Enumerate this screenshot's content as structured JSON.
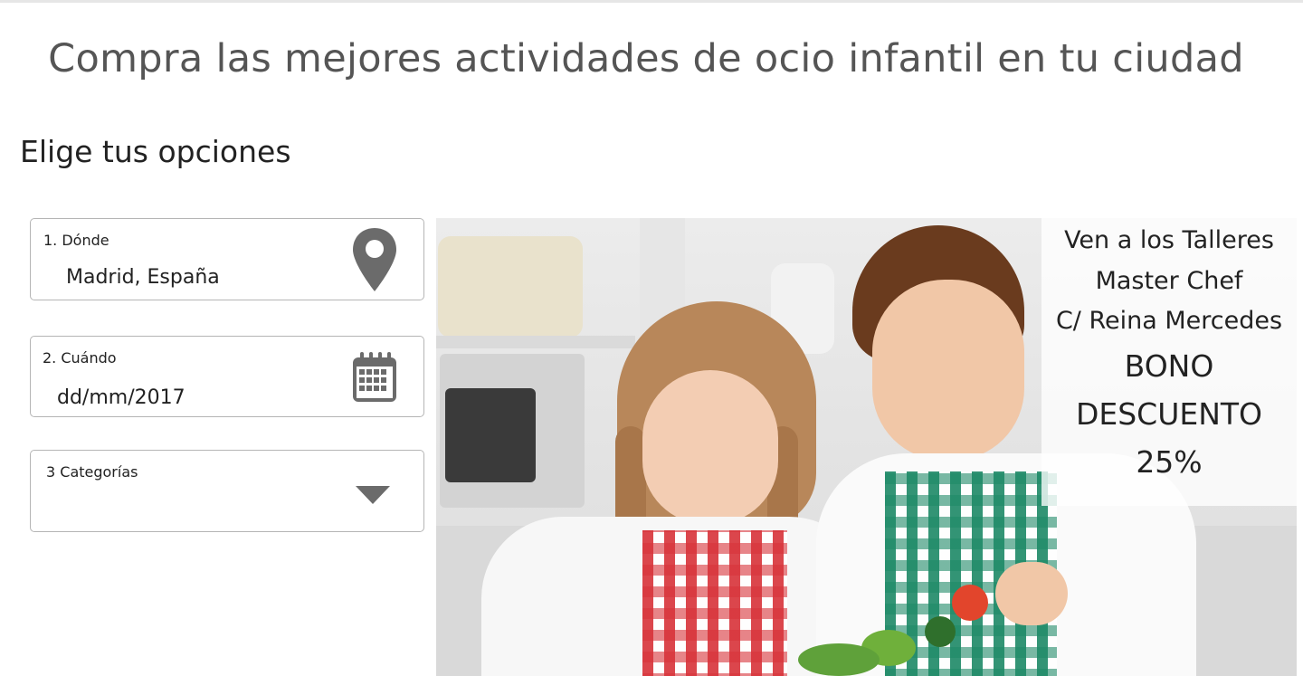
{
  "header": {
    "headline": "Compra las mejores actividades de ocio infantil en tu ciudad",
    "subhead": "Elige tus opciones"
  },
  "form": {
    "where": {
      "label": "1. Dónde",
      "value": "Madrid, España",
      "icon": "map-pin-icon"
    },
    "when": {
      "label": "2. Cuándo",
      "value": "dd/mm/2017",
      "icon": "calendar-icon"
    },
    "category": {
      "label": "3 Categorías",
      "value": "",
      "icon": "chevron-down-icon"
    }
  },
  "promo": {
    "line1": "Ven a los Talleres",
    "line2": "Master Chef",
    "line3": "C/ Reina Mercedes",
    "line4": "BONO",
    "line5": "DESCUENTO",
    "line6": "25%"
  },
  "colors": {
    "headline": "#555555",
    "text": "#222222",
    "border": "#b5b5b5",
    "icon": "#6b6b6b"
  }
}
